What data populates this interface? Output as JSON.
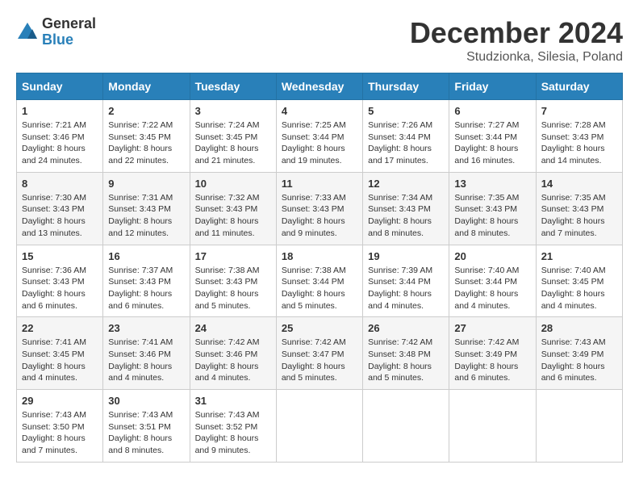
{
  "header": {
    "logo_general": "General",
    "logo_blue": "Blue",
    "month_title": "December 2024",
    "location": "Studzionka, Silesia, Poland"
  },
  "weekdays": [
    "Sunday",
    "Monday",
    "Tuesday",
    "Wednesday",
    "Thursday",
    "Friday",
    "Saturday"
  ],
  "weeks": [
    [
      {
        "day": "1",
        "info": "Sunrise: 7:21 AM\nSunset: 3:46 PM\nDaylight: 8 hours and 24 minutes."
      },
      {
        "day": "2",
        "info": "Sunrise: 7:22 AM\nSunset: 3:45 PM\nDaylight: 8 hours and 22 minutes."
      },
      {
        "day": "3",
        "info": "Sunrise: 7:24 AM\nSunset: 3:45 PM\nDaylight: 8 hours and 21 minutes."
      },
      {
        "day": "4",
        "info": "Sunrise: 7:25 AM\nSunset: 3:44 PM\nDaylight: 8 hours and 19 minutes."
      },
      {
        "day": "5",
        "info": "Sunrise: 7:26 AM\nSunset: 3:44 PM\nDaylight: 8 hours and 17 minutes."
      },
      {
        "day": "6",
        "info": "Sunrise: 7:27 AM\nSunset: 3:44 PM\nDaylight: 8 hours and 16 minutes."
      },
      {
        "day": "7",
        "info": "Sunrise: 7:28 AM\nSunset: 3:43 PM\nDaylight: 8 hours and 14 minutes."
      }
    ],
    [
      {
        "day": "8",
        "info": "Sunrise: 7:30 AM\nSunset: 3:43 PM\nDaylight: 8 hours and 13 minutes."
      },
      {
        "day": "9",
        "info": "Sunrise: 7:31 AM\nSunset: 3:43 PM\nDaylight: 8 hours and 12 minutes."
      },
      {
        "day": "10",
        "info": "Sunrise: 7:32 AM\nSunset: 3:43 PM\nDaylight: 8 hours and 11 minutes."
      },
      {
        "day": "11",
        "info": "Sunrise: 7:33 AM\nSunset: 3:43 PM\nDaylight: 8 hours and 9 minutes."
      },
      {
        "day": "12",
        "info": "Sunrise: 7:34 AM\nSunset: 3:43 PM\nDaylight: 8 hours and 8 minutes."
      },
      {
        "day": "13",
        "info": "Sunrise: 7:35 AM\nSunset: 3:43 PM\nDaylight: 8 hours and 8 minutes."
      },
      {
        "day": "14",
        "info": "Sunrise: 7:35 AM\nSunset: 3:43 PM\nDaylight: 8 hours and 7 minutes."
      }
    ],
    [
      {
        "day": "15",
        "info": "Sunrise: 7:36 AM\nSunset: 3:43 PM\nDaylight: 8 hours and 6 minutes."
      },
      {
        "day": "16",
        "info": "Sunrise: 7:37 AM\nSunset: 3:43 PM\nDaylight: 8 hours and 6 minutes."
      },
      {
        "day": "17",
        "info": "Sunrise: 7:38 AM\nSunset: 3:43 PM\nDaylight: 8 hours and 5 minutes."
      },
      {
        "day": "18",
        "info": "Sunrise: 7:38 AM\nSunset: 3:44 PM\nDaylight: 8 hours and 5 minutes."
      },
      {
        "day": "19",
        "info": "Sunrise: 7:39 AM\nSunset: 3:44 PM\nDaylight: 8 hours and 4 minutes."
      },
      {
        "day": "20",
        "info": "Sunrise: 7:40 AM\nSunset: 3:44 PM\nDaylight: 8 hours and 4 minutes."
      },
      {
        "day": "21",
        "info": "Sunrise: 7:40 AM\nSunset: 3:45 PM\nDaylight: 8 hours and 4 minutes."
      }
    ],
    [
      {
        "day": "22",
        "info": "Sunrise: 7:41 AM\nSunset: 3:45 PM\nDaylight: 8 hours and 4 minutes."
      },
      {
        "day": "23",
        "info": "Sunrise: 7:41 AM\nSunset: 3:46 PM\nDaylight: 8 hours and 4 minutes."
      },
      {
        "day": "24",
        "info": "Sunrise: 7:42 AM\nSunset: 3:46 PM\nDaylight: 8 hours and 4 minutes."
      },
      {
        "day": "25",
        "info": "Sunrise: 7:42 AM\nSunset: 3:47 PM\nDaylight: 8 hours and 5 minutes."
      },
      {
        "day": "26",
        "info": "Sunrise: 7:42 AM\nSunset: 3:48 PM\nDaylight: 8 hours and 5 minutes."
      },
      {
        "day": "27",
        "info": "Sunrise: 7:42 AM\nSunset: 3:49 PM\nDaylight: 8 hours and 6 minutes."
      },
      {
        "day": "28",
        "info": "Sunrise: 7:43 AM\nSunset: 3:49 PM\nDaylight: 8 hours and 6 minutes."
      }
    ],
    [
      {
        "day": "29",
        "info": "Sunrise: 7:43 AM\nSunset: 3:50 PM\nDaylight: 8 hours and 7 minutes."
      },
      {
        "day": "30",
        "info": "Sunrise: 7:43 AM\nSunset: 3:51 PM\nDaylight: 8 hours and 8 minutes."
      },
      {
        "day": "31",
        "info": "Sunrise: 7:43 AM\nSunset: 3:52 PM\nDaylight: 8 hours and 9 minutes."
      },
      null,
      null,
      null,
      null
    ]
  ]
}
